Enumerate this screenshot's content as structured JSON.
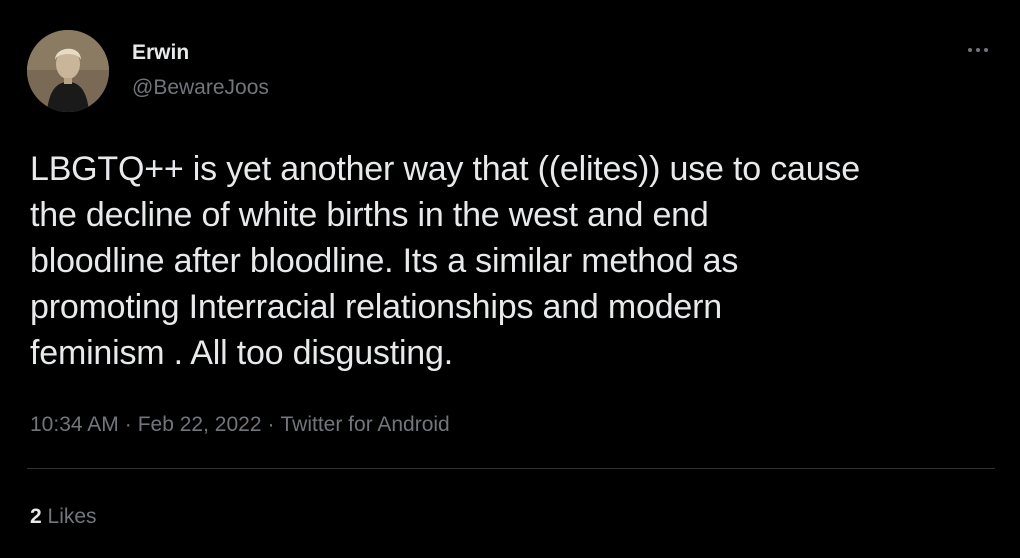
{
  "user": {
    "name": "Erwin",
    "handle": "@BewareJoos"
  },
  "tweet": {
    "text": "LBGTQ++ is yet another way that ((elites)) use to cause\nthe decline of white births in the west and end\nbloodline after bloodline. Its a similar method as\npromoting Interracial relationships and modern\nfeminism . All too disgusting.",
    "time": "10:34 AM",
    "date": "Feb 22, 2022",
    "source": "Twitter for Android",
    "separator": "·"
  },
  "stats": {
    "likes_count": "2",
    "likes_label": "Likes"
  },
  "icons": {
    "more": "more-horizontal-icon"
  },
  "colors": {
    "background": "#000000",
    "primary_text": "#e7e9ea",
    "secondary_text": "#71767b",
    "divider": "#2f3336"
  }
}
